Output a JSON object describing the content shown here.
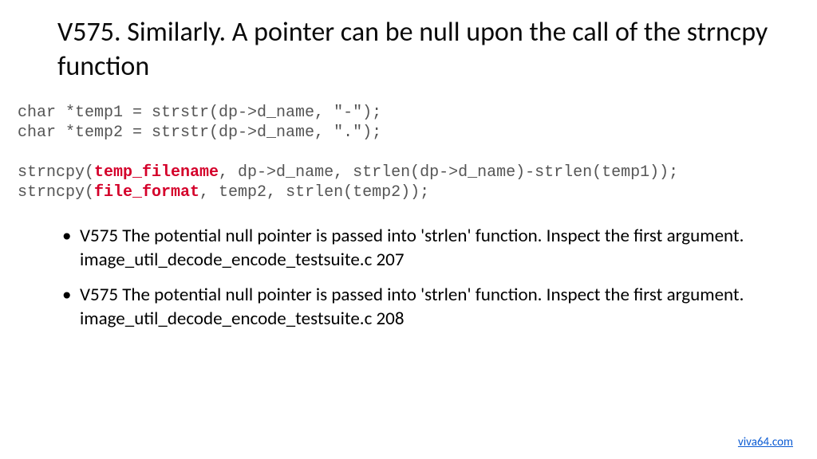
{
  "title": "V575. Similarly. A pointer can be null upon the call of the strncpy function",
  "code": {
    "l1a": "char *temp1 = strstr(dp->d_name, \"-\");",
    "l2a": "char *temp2 = strstr(dp->d_name, \".\");",
    "l3_pre": "strncpy(",
    "l3_hl": "temp_filename",
    "l3_post": ", dp->d_name, strlen(dp->d_name)-strlen(temp1));",
    "l4_pre": "strncpy(",
    "l4_hl": "file_format",
    "l4_post": ", temp2, strlen(temp2));"
  },
  "bullets": [
    "V575 The potential null pointer is passed into 'strlen' function. Inspect the first argument. image_util_decode_encode_testsuite.c 207",
    "V575 The potential null pointer is passed into 'strlen' function. Inspect the first argument. image_util_decode_encode_testsuite.c 208"
  ],
  "footer_link": "viva64.com"
}
